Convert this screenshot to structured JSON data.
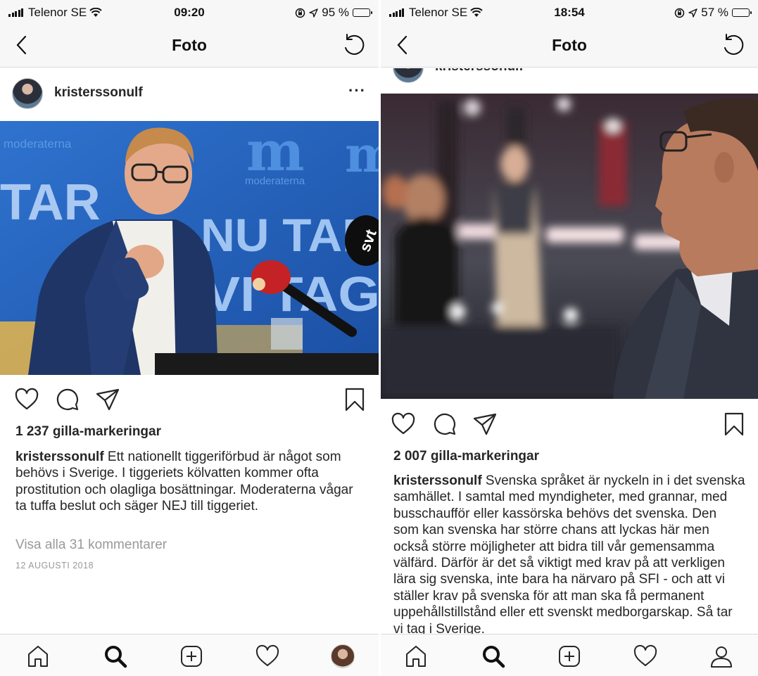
{
  "screens": [
    {
      "status": {
        "carrier": "Telenor SE",
        "time": "09:20",
        "battery": "95 %",
        "battery_level": 0.95
      },
      "nav": {
        "title": "Foto",
        "back_icon": "chevron-left-icon",
        "refresh_icon": "refresh-icon"
      },
      "post": {
        "username": "kristerssonulf",
        "more_label": "···",
        "likes": "1 237 gilla-markeringar",
        "caption_user": "kristerssonulf",
        "caption_text": " Ett nationellt tiggeriförbud är något som behövs i Sverige. I tiggeriets kölvatten kommer ofta prostitution och olagliga bosättningar. Moderaterna vågar ta tuffa beslut och säger NEJ till tiggeriet.",
        "comments_link": "Visa alla 31 kommentarer",
        "date": "12 AUGUSTI 2018",
        "photo": {
          "backdrop_logo": "m",
          "backdrop_brand": "moderaterna",
          "backdrop_slogan_1": "NU TAR",
          "backdrop_slogan_2": "VI TAG",
          "backdrop_left_text": "TAR",
          "mic_logo": "svt"
        }
      },
      "tabbar": [
        "home-icon",
        "search-icon",
        "add-icon",
        "heart-icon",
        "profile-avatar"
      ]
    },
    {
      "status": {
        "carrier": "Telenor SE",
        "time": "18:54",
        "battery": "57 %",
        "battery_level": 0.57
      },
      "nav": {
        "title": "Foto",
        "back_icon": "chevron-left-icon",
        "refresh_icon": "refresh-icon"
      },
      "post": {
        "username": "kristerssonulf",
        "likes": "2 007 gilla-markeringar",
        "caption_user": "kristerssonulf",
        "caption_text": " Svenska språket är nyckeln in i det svenska samhället. I samtal med myndigheter, med grannar, med busschaufför eller kassörska behövs det svenska. Den som kan svenska har större chans att lyckas här men också  större möjligheter att bidra till vår gemensamma välfärd. Därför är det så viktigt med krav på att verkligen lära sig svenska, inte bara ha närvaro på SFI - och att vi ställer krav på svenska för att man ska få permanent uppehållstillstånd eller ett svenskt medborgarskap. Så tar vi tag i Sverige."
      },
      "tabbar": [
        "home-icon",
        "search-icon",
        "add-icon",
        "heart-icon",
        "profile-icon"
      ]
    }
  ],
  "colors": {
    "text": "#262626",
    "muted": "#999999",
    "bar_bg": "#f7f7f7",
    "border": "#dbdbdb",
    "moderaterna_blue": "#1d5fbf"
  }
}
